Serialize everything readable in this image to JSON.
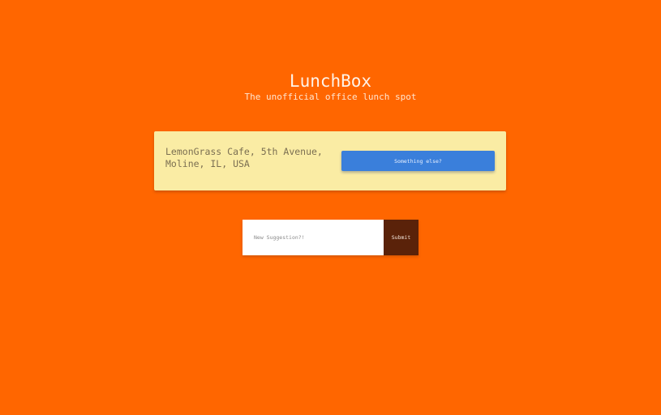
{
  "header": {
    "title": "LunchBox",
    "subtitle": "The unofficial office lunch spot"
  },
  "suggestion_card": {
    "place_line1": "LemonGrass Cafe, 5th Avenue,",
    "place_line2": "Moline, IL, USA",
    "else_button_label": "Something else?"
  },
  "suggest_form": {
    "placeholder": "New Suggestion?!",
    "value": "",
    "submit_label": "Submit"
  },
  "colors": {
    "background": "#ff6600",
    "card": "#faeca4",
    "else_button": "#3a7fdb",
    "submit_button": "#5a2209"
  }
}
